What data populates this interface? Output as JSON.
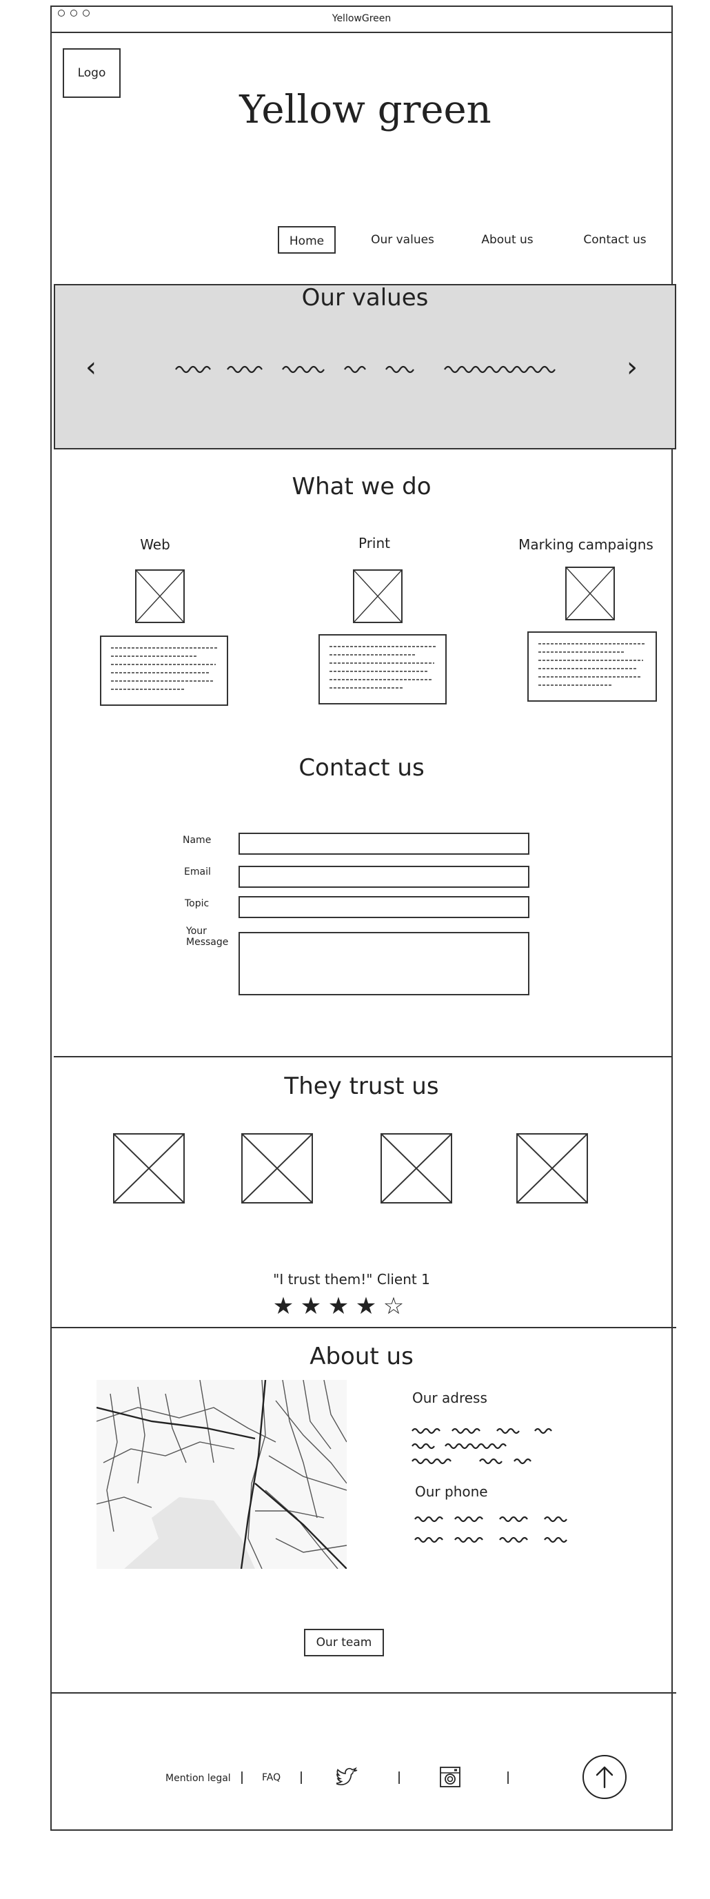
{
  "window": {
    "title": "YellowGreen"
  },
  "header": {
    "logo_label": "Logo",
    "site_title": "Yellow green",
    "nav": [
      {
        "label": "Home",
        "active": true
      },
      {
        "label": "Our values"
      },
      {
        "label": "About us"
      },
      {
        "label": "Contact us"
      }
    ]
  },
  "values": {
    "title": "Our values",
    "prev_icon": "chevron-left-icon",
    "next_icon": "chevron-right-icon"
  },
  "services": {
    "title": "What we do",
    "items": [
      {
        "title": "Web",
        "icon": "image-placeholder"
      },
      {
        "title": "Print",
        "icon": "image-placeholder"
      },
      {
        "title": "Marking campaigns",
        "icon": "image-placeholder"
      }
    ]
  },
  "contact": {
    "title": "Contact us",
    "fields": {
      "name_label": "Name",
      "email_label": "Email",
      "topic_label": "Topic",
      "message_label_line1": "Your",
      "message_label_line2": "Message",
      "name_value": "",
      "email_value": "",
      "topic_value": "",
      "message_value": ""
    }
  },
  "trust": {
    "title": "They trust us",
    "testimonial": "\"I trust them!\" Client 1",
    "rating": 4,
    "rating_max": 5
  },
  "about": {
    "title": "About us",
    "address_label": "Our adress",
    "phone_label": "Our phone",
    "team_button": "Our team"
  },
  "footer": {
    "mention_legal": "Mention legal",
    "faq": "FAQ",
    "twitter_icon": "twitter-icon",
    "instagram_icon": "instagram-icon",
    "up_icon": "arrow-up-icon"
  }
}
